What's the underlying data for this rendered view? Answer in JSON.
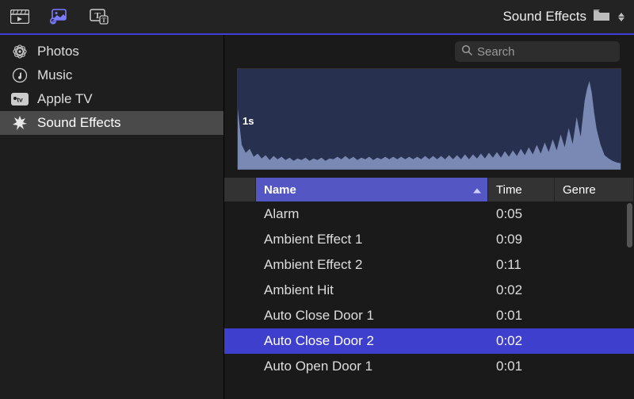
{
  "header": {
    "title": "Sound Effects"
  },
  "sidebar": {
    "items": [
      {
        "icon": "photos-icon",
        "label": "Photos"
      },
      {
        "icon": "music-icon",
        "label": "Music"
      },
      {
        "icon": "appletv-icon",
        "label": "Apple TV"
      },
      {
        "icon": "burst-icon",
        "label": "Sound Effects",
        "selected": true
      }
    ]
  },
  "search": {
    "placeholder": "Search",
    "value": ""
  },
  "waveform": {
    "time_label": "1s"
  },
  "table": {
    "columns": {
      "name": "Name",
      "time": "Time",
      "genre": "Genre"
    },
    "sort": {
      "column": "name",
      "direction": "asc"
    },
    "rows": [
      {
        "name": "Alarm",
        "time": "0:05",
        "genre": ""
      },
      {
        "name": "Ambient Effect 1",
        "time": "0:09",
        "genre": ""
      },
      {
        "name": "Ambient Effect 2",
        "time": "0:11",
        "genre": ""
      },
      {
        "name": "Ambient Hit",
        "time": "0:02",
        "genre": ""
      },
      {
        "name": "Auto Close Door 1",
        "time": "0:01",
        "genre": ""
      },
      {
        "name": "Auto Close Door 2",
        "time": "0:02",
        "genre": "",
        "selected": true
      },
      {
        "name": "Auto Open Door 1",
        "time": "0:01",
        "genre": ""
      }
    ]
  },
  "colors": {
    "accent": "#5456c3",
    "selection": "#3f3fcd",
    "toolbar_active": "#7b7bff"
  }
}
